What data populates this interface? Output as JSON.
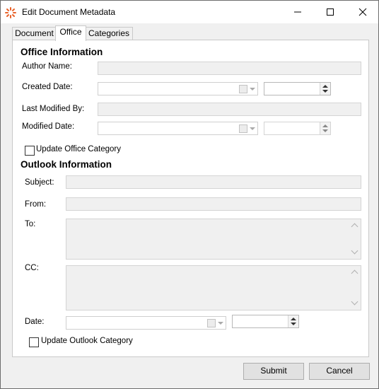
{
  "window": {
    "title": "Edit Document Metadata",
    "icon": "app-logo-icon",
    "controls": [
      "minimize-icon",
      "maximize-icon",
      "close-icon"
    ]
  },
  "tabs": [
    {
      "label": "Document",
      "active": false
    },
    {
      "label": "Office",
      "active": true
    },
    {
      "label": "Categories",
      "active": false
    }
  ],
  "office": {
    "heading": "Office Information",
    "author_label": "Author Name:",
    "author_value": "",
    "created_label": "Created Date:",
    "created_date": "",
    "created_time": "",
    "modified_by_label": "Last Modified By:",
    "modified_by_value": "",
    "modified_label": "Modified Date:",
    "modified_date": "",
    "modified_time": "",
    "update_category_label": "Update Office Category",
    "update_category_checked": false
  },
  "outlook": {
    "heading": "Outlook Information",
    "subject_label": "Subject:",
    "subject_value": "",
    "from_label": "From:",
    "from_value": "",
    "to_label": "To:",
    "to_value": "",
    "cc_label": "CC:",
    "cc_value": "",
    "date_label": "Date:",
    "date_value": "",
    "time_value": "",
    "update_category_label": "Update Outlook Category",
    "update_category_checked": false
  },
  "footer": {
    "submit_label": "Submit",
    "cancel_label": "Cancel"
  },
  "colors": {
    "app_icon": "#e8622a",
    "panel_bg": "#ffffff",
    "readonly_bg": "#f0f0f0"
  }
}
